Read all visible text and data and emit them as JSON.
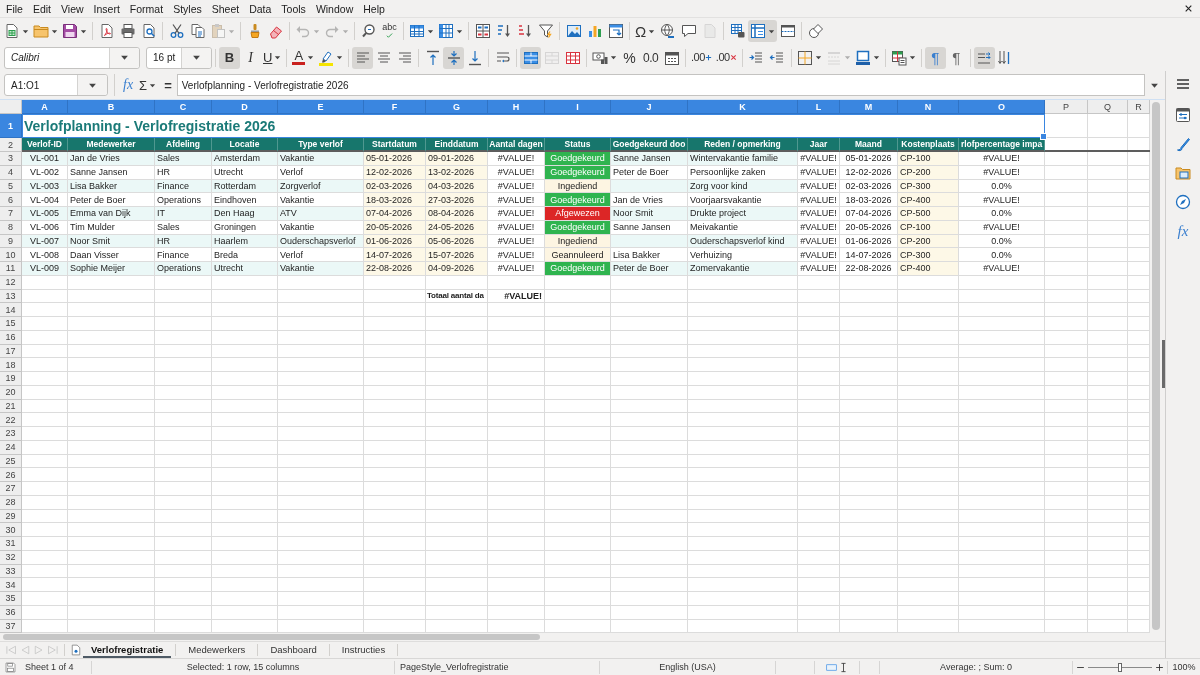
{
  "menu_bar": [
    "File",
    "Edit",
    "View",
    "Insert",
    "Format",
    "Styles",
    "Sheet",
    "Data",
    "Tools",
    "Window",
    "Help"
  ],
  "standard_toolbar": [
    [
      {
        "active": false,
        "disabled": false,
        "dropdown": true
      },
      {
        "active": false,
        "disabled": false,
        "dropdown": true
      },
      {
        "active": false,
        "disabled": false,
        "dropdown": true
      }
    ],
    [
      {
        "active": false,
        "disabled": false,
        "dropdown": false
      },
      {
        "active": false,
        "disabled": false,
        "dropdown": false
      },
      {
        "active": false,
        "disabled": false,
        "dropdown": false
      }
    ],
    [
      {
        "active": false,
        "disabled": false,
        "dropdown": false
      },
      {
        "active": false,
        "disabled": false,
        "dropdown": false
      },
      {
        "active": false,
        "disabled": true,
        "dropdown": true
      }
    ],
    [
      {
        "active": false,
        "disabled": false,
        "dropdown": false
      },
      {
        "active": false,
        "disabled": false,
        "dropdown": false
      }
    ],
    [
      {
        "active": false,
        "disabled": true,
        "dropdown": true
      },
      {
        "active": false,
        "disabled": true,
        "dropdown": true
      }
    ],
    [
      {
        "active": false,
        "disabled": false,
        "dropdown": false
      },
      {
        "label": "abc",
        "active": false,
        "disabled": false,
        "dropdown": false
      }
    ],
    [
      {
        "active": false,
        "disabled": false,
        "dropdown": true
      },
      {
        "active": false,
        "disabled": false,
        "dropdown": true
      }
    ],
    [
      {
        "active": false,
        "disabled": false,
        "dropdown": false
      },
      {
        "active": false,
        "disabled": false,
        "dropdown": false
      },
      {
        "active": false,
        "disabled": false,
        "dropdown": false
      },
      {
        "active": false,
        "disabled": false,
        "dropdown": false
      }
    ],
    [
      {
        "active": false,
        "disabled": false,
        "dropdown": false
      },
      {
        "active": false,
        "disabled": false,
        "dropdown": false
      },
      {
        "active": false,
        "disabled": false,
        "dropdown": false
      }
    ],
    [
      {
        "label": "Ω",
        "active": false,
        "disabled": false,
        "dropdown": true
      },
      {
        "active": false,
        "disabled": false,
        "dropdown": false
      },
      {
        "active": false,
        "disabled": false,
        "dropdown": false
      },
      {
        "active": false,
        "disabled": true,
        "dropdown": false
      }
    ],
    [
      {
        "active": false,
        "disabled": false,
        "dropdown": false
      },
      {
        "active": true,
        "disabled": false,
        "dropdown": true
      },
      {
        "active": false,
        "disabled": false,
        "dropdown": false
      }
    ],
    [
      {
        "active": false,
        "disabled": false,
        "dropdown": false
      }
    ]
  ],
  "formatting_toolbar": {
    "font_name": "Calibri",
    "font_size": "16 pt",
    "groups": [
      [
        {
          "label": "B",
          "active": true,
          "disabled": false,
          "dropdown": false
        },
        {
          "label": "I",
          "active": false,
          "disabled": false,
          "dropdown": false
        },
        {
          "label": "U",
          "active": false,
          "disabled": false,
          "dropdown": true
        }
      ],
      [
        {
          "label": "A",
          "active": false,
          "disabled": false,
          "dropdown": true
        },
        {
          "active": false,
          "disabled": false,
          "dropdown": true
        }
      ],
      [
        {
          "active": true,
          "disabled": false,
          "dropdown": false
        },
        {
          "active": false,
          "disabled": false,
          "dropdown": false
        },
        {
          "active": false,
          "disabled": false,
          "dropdown": false
        }
      ],
      [
        {
          "active": false,
          "disabled": false,
          "dropdown": false
        },
        {
          "active": true,
          "disabled": false,
          "dropdown": false
        },
        {
          "active": false,
          "disabled": false,
          "dropdown": false
        }
      ],
      [
        {
          "active": false,
          "disabled": false,
          "dropdown": false
        }
      ],
      [
        {
          "active": true,
          "disabled": false,
          "dropdown": false
        },
        {
          "active": false,
          "disabled": true,
          "dropdown": false
        },
        {
          "active": false,
          "disabled": false,
          "dropdown": false
        }
      ],
      [
        {
          "active": false,
          "disabled": false,
          "dropdown": true
        },
        {
          "label": "%",
          "active": false,
          "disabled": false,
          "dropdown": false
        },
        {
          "label": "0.0",
          "active": false,
          "disabled": false,
          "dropdown": false
        },
        {
          "active": false,
          "disabled": false,
          "dropdown": false
        }
      ],
      [
        {
          "label": ".00",
          "active": false,
          "disabled": false,
          "dropdown": false
        },
        {
          "label": ".00",
          "active": false,
          "disabled": false,
          "dropdown": false
        }
      ],
      [
        {
          "active": false,
          "disabled": false,
          "dropdown": false
        },
        {
          "active": false,
          "disabled": false,
          "dropdown": false
        }
      ],
      [
        {
          "active": false,
          "disabled": false,
          "dropdown": true
        },
        {
          "active": false,
          "disabled": true,
          "dropdown": true
        },
        {
          "active": false,
          "disabled": false,
          "dropdown": true
        }
      ],
      [
        {
          "active": false,
          "disabled": false,
          "dropdown": true
        }
      ],
      [
        {
          "label": "¶",
          "active": true,
          "disabled": false,
          "dropdown": false
        },
        {
          "label": "¶",
          "active": false,
          "disabled": false,
          "dropdown": false
        }
      ],
      [
        {
          "active": true,
          "disabled": false,
          "dropdown": false
        },
        {
          "active": false,
          "disabled": false,
          "dropdown": false
        }
      ]
    ]
  },
  "formula_bar": {
    "name_box": "A1:O1",
    "function_wizard": "fx",
    "sum": "Σ",
    "equals": "=",
    "content": "Verlofplanning - Verlofregistratie 2026"
  },
  "sheet": {
    "column_headers": [
      {
        "label": "A",
        "selected": true
      },
      {
        "label": "B",
        "selected": true
      },
      {
        "label": "C",
        "selected": true
      },
      {
        "label": "D",
        "selected": true
      },
      {
        "label": "E",
        "selected": true
      },
      {
        "label": "F",
        "selected": true
      },
      {
        "label": "G",
        "selected": true
      },
      {
        "label": "H",
        "selected": true
      },
      {
        "label": "I",
        "selected": true
      },
      {
        "label": "J",
        "selected": true
      },
      {
        "label": "K",
        "selected": true
      },
      {
        "label": "L",
        "selected": true
      },
      {
        "label": "M",
        "selected": true
      },
      {
        "label": "N",
        "selected": true
      },
      {
        "label": "O",
        "selected": true
      },
      {
        "label": "P",
        "selected": false
      },
      {
        "label": "Q",
        "selected": false
      },
      {
        "label": "R",
        "selected": false
      }
    ],
    "row_headers": [
      {
        "label": "1",
        "selected": true
      },
      {
        "label": "2",
        "selected": false
      },
      {
        "label": "3",
        "selected": false
      },
      {
        "label": "4",
        "selected": false
      },
      {
        "label": "5",
        "selected": false
      },
      {
        "label": "6",
        "selected": false
      },
      {
        "label": "7",
        "selected": false
      },
      {
        "label": "8",
        "selected": false
      },
      {
        "label": "9",
        "selected": false
      },
      {
        "label": "10",
        "selected": false
      },
      {
        "label": "11",
        "selected": false
      },
      {
        "label": "12",
        "selected": false
      },
      {
        "label": "13",
        "selected": false
      },
      {
        "label": "14",
        "selected": false
      },
      {
        "label": "15",
        "selected": false
      },
      {
        "label": "16",
        "selected": false
      },
      {
        "label": "17",
        "selected": false
      },
      {
        "label": "18",
        "selected": false
      },
      {
        "label": "19",
        "selected": false
      },
      {
        "label": "20",
        "selected": false
      },
      {
        "label": "21",
        "selected": false
      },
      {
        "label": "22",
        "selected": false
      },
      {
        "label": "23",
        "selected": false
      },
      {
        "label": "24",
        "selected": false
      },
      {
        "label": "25",
        "selected": false
      },
      {
        "label": "26",
        "selected": false
      },
      {
        "label": "27",
        "selected": false
      },
      {
        "label": "28",
        "selected": false
      },
      {
        "label": "29",
        "selected": false
      },
      {
        "label": "30",
        "selected": false
      },
      {
        "label": "31",
        "selected": false
      },
      {
        "label": "32",
        "selected": false
      },
      {
        "label": "33",
        "selected": false
      },
      {
        "label": "34",
        "selected": false
      },
      {
        "label": "35",
        "selected": false
      },
      {
        "label": "36",
        "selected": false
      },
      {
        "label": "37",
        "selected": false
      }
    ],
    "title": "Verlofplanning - Verlofregistratie 2026",
    "table": {
      "columns": [
        {
          "heading": "Verlof-ID",
          "kind": "key"
        },
        {
          "heading": "Medewerker",
          "kind": "text"
        },
        {
          "heading": "Afdeling",
          "kind": "text"
        },
        {
          "heading": "Locatie",
          "kind": "text"
        },
        {
          "heading": "Type verlof",
          "kind": "text"
        },
        {
          "heading": "Startdatum",
          "kind": "input"
        },
        {
          "heading": "Einddatum",
          "kind": "input"
        },
        {
          "heading": "Aantal dagen",
          "kind": "formula"
        },
        {
          "heading": "Status",
          "kind": "status"
        },
        {
          "heading": "Goedgekeurd doo",
          "kind": "text"
        },
        {
          "heading": "Reden / opmerking",
          "kind": "text"
        },
        {
          "heading": "Jaar",
          "kind": "formula"
        },
        {
          "heading": "Maand",
          "kind": "formula"
        },
        {
          "heading": "Kostenplaats",
          "kind": "input"
        },
        {
          "heading": "rlofpercentage impa",
          "kind": "formula"
        }
      ],
      "rows": [
        {
          "verlof_id": "VL-001",
          "medewerker": "Jan de Vries",
          "afdeling": "Sales",
          "locatie": "Amsterdam",
          "type_verlof": "Vakantie",
          "startdatum": "05-01-2026",
          "einddatum": "09-01-2026",
          "aantal_dagen": "#VALUE!",
          "status": {
            "text": "Goedgekeurd",
            "color": "#2fb44f"
          },
          "column_10": "Sanne Jansen",
          "reden_opmerking": "Wintervakantie familie",
          "jaar": "#VALUE!",
          "maand": "05-01-2026",
          "kostenplaats": "CP-100",
          "column_15": "#VALUE!"
        },
        {
          "verlof_id": "VL-002",
          "medewerker": "Sanne Jansen",
          "afdeling": "HR",
          "locatie": "Utrecht",
          "type_verlof": "Verlof",
          "startdatum": "12-02-2026",
          "einddatum": "13-02-2026",
          "aantal_dagen": "#VALUE!",
          "status": {
            "text": "Goedgekeurd",
            "color": "#2fb44f"
          },
          "column_10": "Peter de Boer",
          "reden_opmerking": "Persoonlijke zaken",
          "jaar": "#VALUE!",
          "maand": "12-02-2026",
          "kostenplaats": "CP-200",
          "column_15": "#VALUE!"
        },
        {
          "verlof_id": "VL-003",
          "medewerker": "Lisa Bakker",
          "afdeling": "Finance",
          "locatie": "Rotterdam",
          "type_verlof": "Zorgverlof",
          "startdatum": "02-03-2026",
          "einddatum": "04-03-2026",
          "aantal_dagen": "#VALUE!",
          "status": {
            "text": "Ingediend",
            "color": "#fdf5e2"
          },
          "reden_opmerking": "Zorg voor kind",
          "jaar": "#VALUE!",
          "maand": "02-03-2026",
          "kostenplaats": "CP-300",
          "column_15": "0.0%"
        },
        {
          "verlof_id": "VL-004",
          "medewerker": "Peter de Boer",
          "afdeling": "Operations",
          "locatie": "Eindhoven",
          "type_verlof": "Vakantie",
          "startdatum": "18-03-2026",
          "einddatum": "27-03-2026",
          "aantal_dagen": "#VALUE!",
          "status": {
            "text": "Goedgekeurd",
            "color": "#2fb44f"
          },
          "column_10": "Jan de Vries",
          "reden_opmerking": "Voorjaarsvakantie",
          "jaar": "#VALUE!",
          "maand": "18-03-2026",
          "kostenplaats": "CP-400",
          "column_15": "#VALUE!"
        },
        {
          "verlof_id": "VL-005",
          "medewerker": "Emma van Dijk",
          "afdeling": "IT",
          "locatie": "Den Haag",
          "type_verlof": "ATV",
          "startdatum": "07-04-2026",
          "einddatum": "08-04-2026",
          "aantal_dagen": "#VALUE!",
          "status": {
            "text": "Afgewezen",
            "color": "#dc2626"
          },
          "column_10": "Noor Smit",
          "reden_opmerking": "Drukte project",
          "jaar": "#VALUE!",
          "maand": "07-04-2026",
          "kostenplaats": "CP-500",
          "column_15": "0.0%"
        },
        {
          "verlof_id": "VL-006",
          "medewerker": "Tim Mulder",
          "afdeling": "Sales",
          "locatie": "Groningen",
          "type_verlof": "Vakantie",
          "startdatum": "20-05-2026",
          "einddatum": "24-05-2026",
          "aantal_dagen": "#VALUE!",
          "status": {
            "text": "Goedgekeurd",
            "color": "#2fb44f"
          },
          "column_10": "Sanne Jansen",
          "reden_opmerking": "Meivakantie",
          "jaar": "#VALUE!",
          "maand": "20-05-2026",
          "kostenplaats": "CP-100",
          "column_15": "#VALUE!"
        },
        {
          "verlof_id": "VL-007",
          "medewerker": "Noor Smit",
          "afdeling": "HR",
          "locatie": "Haarlem",
          "type_verlof": "Ouderschapsverlof",
          "startdatum": "01-06-2026",
          "einddatum": "05-06-2026",
          "aantal_dagen": "#VALUE!",
          "status": {
            "text": "Ingediend",
            "color": "#fdf5e2"
          },
          "reden_opmerking": "Ouderschapsverlof kind",
          "jaar": "#VALUE!",
          "maand": "01-06-2026",
          "kostenplaats": "CP-200",
          "column_15": "0.0%"
        },
        {
          "verlof_id": "VL-008",
          "medewerker": "Daan Visser",
          "afdeling": "Finance",
          "locatie": "Breda",
          "type_verlof": "Verlof",
          "startdatum": "14-07-2026",
          "einddatum": "15-07-2026",
          "aantal_dagen": "#VALUE!",
          "status": {
            "text": "Geannuleerd",
            "color": "#fdf5e2"
          },
          "column_10": "Lisa Bakker",
          "reden_opmerking": "Verhuizing",
          "jaar": "#VALUE!",
          "maand": "14-07-2026",
          "kostenplaats": "CP-300",
          "column_15": "0.0%"
        },
        {
          "verlof_id": "VL-009",
          "medewerker": "Sophie Meijer",
          "afdeling": "Operations",
          "locatie": "Utrecht",
          "type_verlof": "Vakantie",
          "startdatum": "22-08-2026",
          "einddatum": "04-09-2026",
          "aantal_dagen": "#VALUE!",
          "status": {
            "text": "Goedgekeurd",
            "color": "#2fb44f"
          },
          "column_10": "Peter de Boer",
          "reden_opmerking": "Zomervakantie",
          "jaar": "#VALUE!",
          "maand": "22-08-2026",
          "kostenplaats": "CP-400",
          "column_15": "#VALUE!"
        }
      ],
      "total": {
        "label": "Totaal aantal da",
        "value": "#VALUE!"
      }
    }
  },
  "sheet_tabs": {
    "navigation": [
      {
        "disabled": true
      },
      {
        "disabled": true
      },
      {
        "disabled": true
      },
      {
        "disabled": true
      }
    ],
    "tabs": [
      {
        "label": "Verlofregistratie",
        "selected": true
      },
      {
        "label": "Medewerkers",
        "selected": false
      },
      {
        "label": "Dashboard",
        "selected": false
      },
      {
        "label": "Instructies",
        "selected": false
      }
    ]
  },
  "sidebar": {
    "tabs": [
      {
        "selected": false
      },
      {
        "selected": false
      },
      {
        "selected": false
      },
      {
        "selected": false
      },
      {
        "label": "fx",
        "selected": false
      }
    ]
  },
  "status_bar": {
    "sheet": "Sheet 1 of 4",
    "selection": "Selected: 1 row, 15 columns",
    "page_style": "PageStyle_Verlofregistratie",
    "language": "English (USA)",
    "summary": "Average: ; Sum: 0",
    "zoom": {
      "level": 0.5,
      "reading": "100%"
    }
  }
}
